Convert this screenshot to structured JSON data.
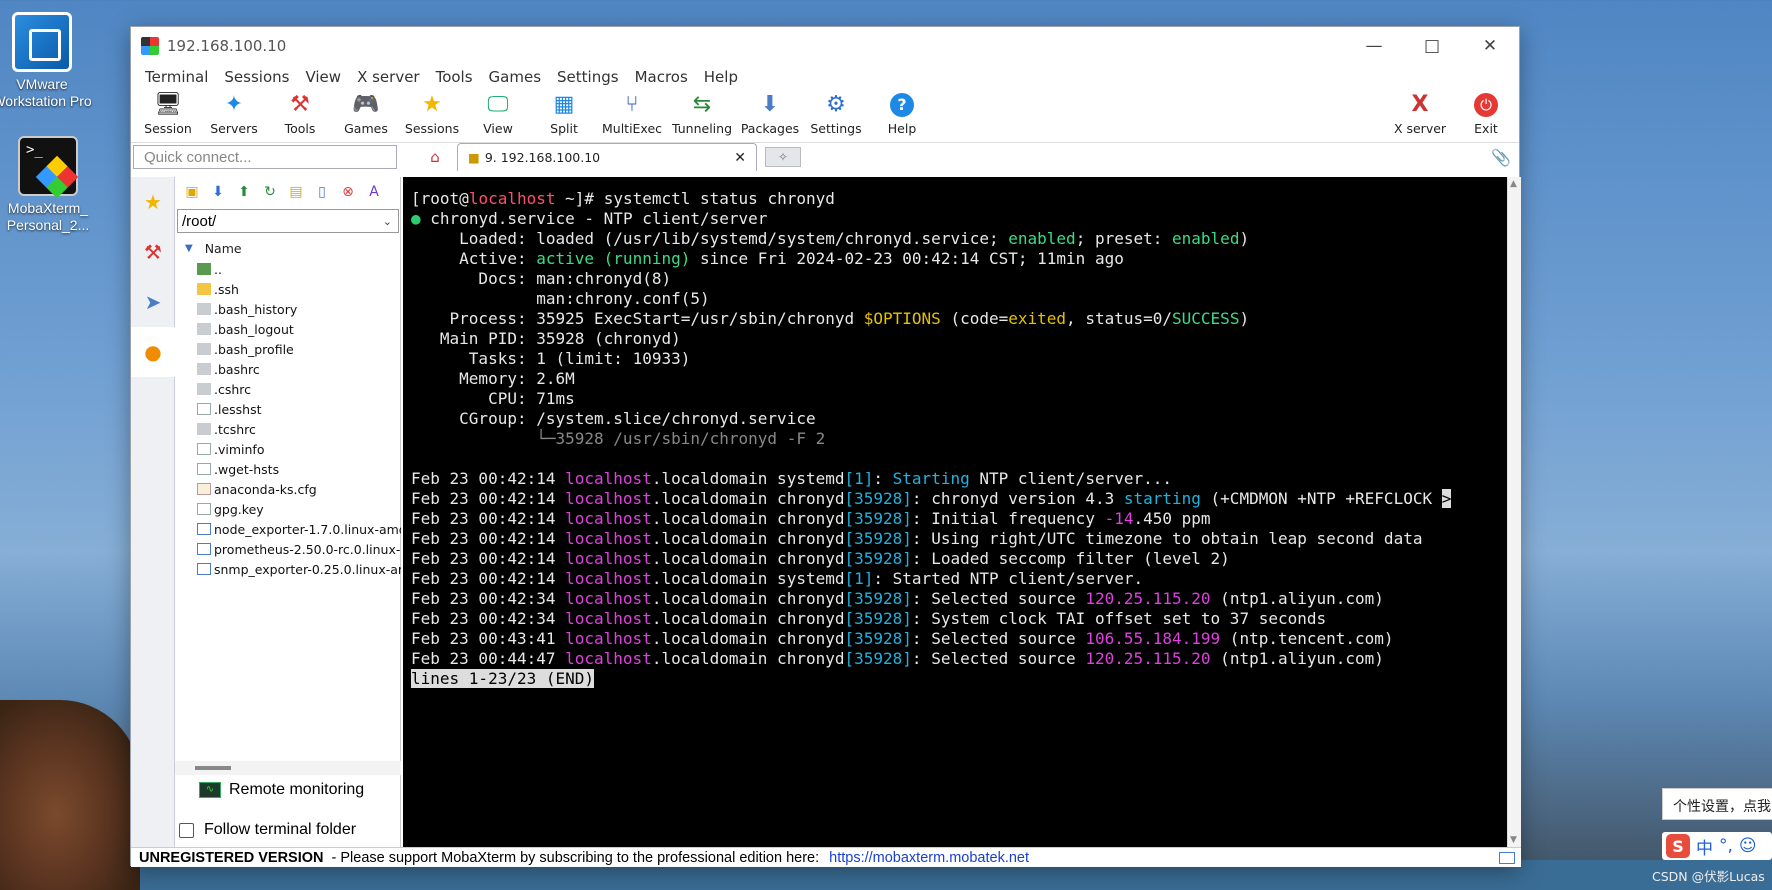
{
  "desktop": {
    "icons": [
      {
        "label": "VMware Workstation Pro"
      },
      {
        "label": "MobaXterm_ Personal_2..."
      }
    ],
    "watermark": "CSDN @伏影Lucas",
    "tooltip": "个性设置，点我",
    "ime": {
      "logo": "S",
      "mode": "中",
      "punct": "°,"
    }
  },
  "window": {
    "title": "192.168.100.10",
    "menu": [
      "Terminal",
      "Sessions",
      "View",
      "X server",
      "Tools",
      "Games",
      "Settings",
      "Macros",
      "Help"
    ],
    "toolbar": [
      "Session",
      "Servers",
      "Tools",
      "Games",
      "Sessions",
      "View",
      "Split",
      "MultiExec",
      "Tunneling",
      "Packages",
      "Settings",
      "Help"
    ],
    "toolbar_right": [
      "X server",
      "Exit"
    ],
    "quick_connect_placeholder": "Quick connect...",
    "active_tab": "9. 192.168.100.10"
  },
  "filebrowser": {
    "path": "/root/",
    "column_name": "Name",
    "files": [
      {
        "name": "..",
        "kind": "up"
      },
      {
        "name": ".ssh",
        "kind": "folder"
      },
      {
        "name": ".bash_history",
        "kind": "hidden"
      },
      {
        "name": ".bash_logout",
        "kind": "hidden"
      },
      {
        "name": ".bash_profile",
        "kind": "hidden"
      },
      {
        "name": ".bashrc",
        "kind": "hidden"
      },
      {
        "name": ".cshrc",
        "kind": "hidden"
      },
      {
        "name": ".lesshst",
        "kind": "doc"
      },
      {
        "name": ".tcshrc",
        "kind": "hidden"
      },
      {
        "name": ".viminfo",
        "kind": "doc"
      },
      {
        "name": ".wget-hsts",
        "kind": "doc"
      },
      {
        "name": "anaconda-ks.cfg",
        "kind": "cfg"
      },
      {
        "name": "gpg.key",
        "kind": "doc"
      },
      {
        "name": "node_exporter-1.7.0.linux-amd",
        "kind": "bin"
      },
      {
        "name": "prometheus-2.50.0-rc.0.linux-a",
        "kind": "bin"
      },
      {
        "name": "snmp_exporter-0.25.0.linux-am",
        "kind": "bin"
      }
    ],
    "remote_monitoring": "Remote monitoring",
    "follow_terminal": "Follow terminal folder"
  },
  "terminal": {
    "prompt_user": "root",
    "prompt_host": "localhost",
    "command": "systemctl status chronyd",
    "service": "chronyd.service - NTP client/server",
    "loaded": "loaded (/usr/lib/systemd/system/chronyd.service; enabled; preset: enabled)",
    "active_state": "active (running)",
    "active_since": "since Fri 2024-02-23 00:42:14 CST; 11min ago",
    "docs1": "man:chronyd(8)",
    "docs2": "man:chrony.conf(5)",
    "process_pre": "35925 ExecStart=/usr/sbin/chronyd ",
    "process_opt": "$OPTIONS",
    "main_pid": "35928 (chronyd)",
    "tasks": "1 (limit: 10933)",
    "memory": "2.6M",
    "cpu": "71ms",
    "cgroup": "/system.slice/chronyd.service",
    "cgroup_child": "└─35928 /usr/sbin/chronyd -F 2",
    "log_prefix": "Feb 23 ",
    "log_host": "localhost",
    "log_domain": ".localdomain ",
    "logs": [
      {
        "time": "00:42:14",
        "unit": "systemd",
        "pid": "1",
        "msg_pre": "",
        "hl": "Starting",
        "hl_color": "c",
        "msg": " NTP client/server...",
        "ip": "",
        "tail": ""
      },
      {
        "time": "00:42:14",
        "unit": "chronyd",
        "pid": "35928",
        "msg_pre": "chronyd version 4.3 ",
        "hl": "starting",
        "hl_color": "c",
        "msg": " (+CMDMON +NTP +REFCLOCK ",
        "ip": "",
        "tail": ">"
      },
      {
        "time": "00:42:14",
        "unit": "chronyd",
        "pid": "35928",
        "msg_pre": "Initial frequency ",
        "hl": "-14",
        "hl_color": "m",
        "msg": ".450 ppm",
        "ip": "",
        "tail": ""
      },
      {
        "time": "00:42:14",
        "unit": "chronyd",
        "pid": "35928",
        "msg_pre": "Using right/UTC timezone to obtain leap second data",
        "hl": "",
        "hl_color": "c",
        "msg": "",
        "ip": "",
        "tail": ""
      },
      {
        "time": "00:42:14",
        "unit": "chronyd",
        "pid": "35928",
        "msg_pre": "Loaded seccomp filter (level 2)",
        "hl": "",
        "hl_color": "c",
        "msg": "",
        "ip": "",
        "tail": ""
      },
      {
        "time": "00:42:14",
        "unit": "systemd",
        "pid": "1",
        "msg_pre": "Started NTP client/server.",
        "hl": "",
        "hl_color": "c",
        "msg": "",
        "ip": "",
        "tail": ""
      },
      {
        "time": "00:42:34",
        "unit": "chronyd",
        "pid": "35928",
        "msg_pre": "Selected source ",
        "hl": "120.25.115.20",
        "hl_color": "m",
        "msg": " (ntp1.aliyun.com)",
        "ip": "",
        "tail": ""
      },
      {
        "time": "00:42:34",
        "unit": "chronyd",
        "pid": "35928",
        "msg_pre": "System clock TAI offset set to 37 seconds",
        "hl": "",
        "hl_color": "c",
        "msg": "",
        "ip": "",
        "tail": ""
      },
      {
        "time": "00:43:41",
        "unit": "chronyd",
        "pid": "35928",
        "msg_pre": "Selected source ",
        "hl": "106.55.184.199",
        "hl_color": "m",
        "msg": " (ntp.tencent.com)",
        "ip": "",
        "tail": ""
      },
      {
        "time": "00:44:47",
        "unit": "chronyd",
        "pid": "35928",
        "msg_pre": "Selected source ",
        "hl": "120.25.115.20",
        "hl_color": "m",
        "msg": " (ntp1.aliyun.com)",
        "ip": "",
        "tail": ""
      }
    ],
    "pager_status": "lines 1-23/23 (END)"
  },
  "statusbar": {
    "unregistered": "UNREGISTERED VERSION",
    "message": "-  Please support MobaXterm by subscribing to the professional edition here:",
    "link": "https://mobaxterm.mobatek.net"
  }
}
